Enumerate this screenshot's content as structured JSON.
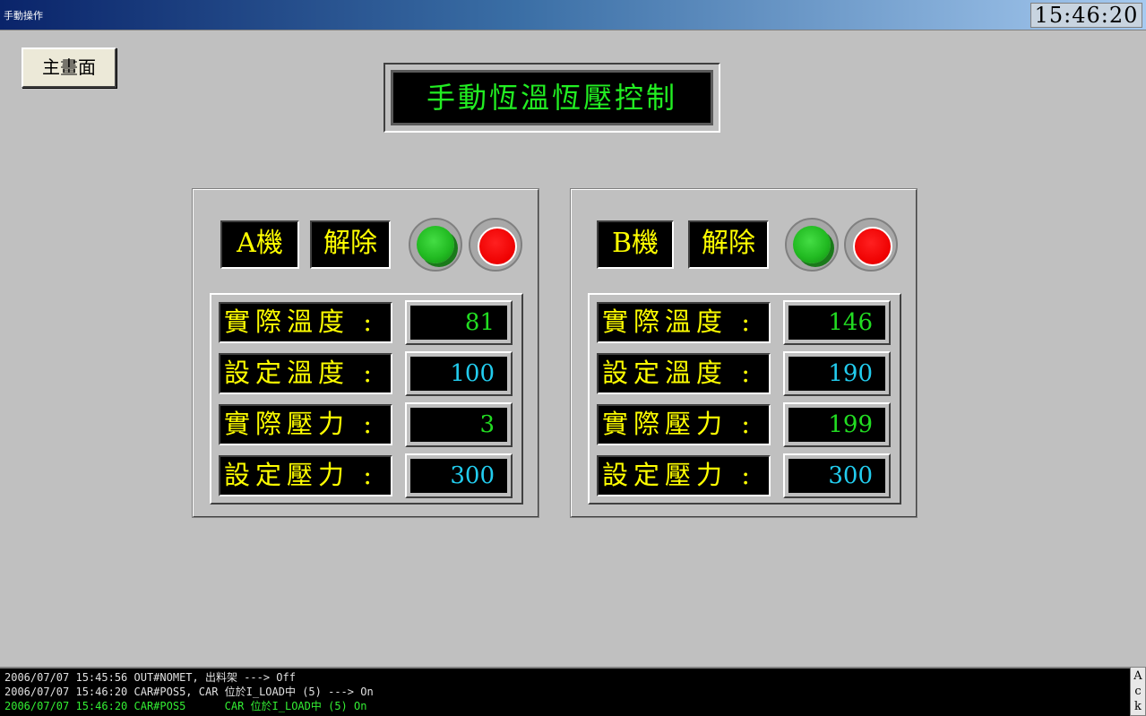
{
  "window": {
    "title": "手動操作",
    "clock": "15:46:20"
  },
  "main_button": "主畫面",
  "page_title": "手動恆溫恆壓控制",
  "machines": [
    {
      "name": "A機",
      "release_label": "解除",
      "rows": [
        {
          "label": "實際溫度 :",
          "value": "81",
          "color": "green"
        },
        {
          "label": "設定溫度 :",
          "value": "100",
          "color": "cyan"
        },
        {
          "label": "實際壓力 :",
          "value": "3",
          "color": "green"
        },
        {
          "label": "設定壓力 :",
          "value": "300",
          "color": "cyan"
        }
      ]
    },
    {
      "name": "B機",
      "release_label": "解除",
      "rows": [
        {
          "label": "實際溫度 :",
          "value": "146",
          "color": "green"
        },
        {
          "label": "設定溫度 :",
          "value": "190",
          "color": "cyan"
        },
        {
          "label": "實際壓力 :",
          "value": "199",
          "color": "green"
        },
        {
          "label": "設定壓力 :",
          "value": "300",
          "color": "cyan"
        }
      ]
    }
  ],
  "log": [
    "2006/07/07 15:45:56 OUT#NOMET, 出料架 ---> Off",
    "2006/07/07 15:46:20 CAR#POS5, CAR 位於I_LOAD中 (5) ---> On",
    "2006/07/07 15:46:20 CAR#POS5      CAR 位於I_LOAD中 (5) On"
  ],
  "ack_label": "Ack",
  "colors": {
    "green_text": "#22dd22",
    "cyan_text": "#22ccee",
    "label_yellow": "#ffff00",
    "title_green": "#22ee22"
  },
  "icons": [
    "start-lamp-green",
    "stop-lamp-red"
  ]
}
